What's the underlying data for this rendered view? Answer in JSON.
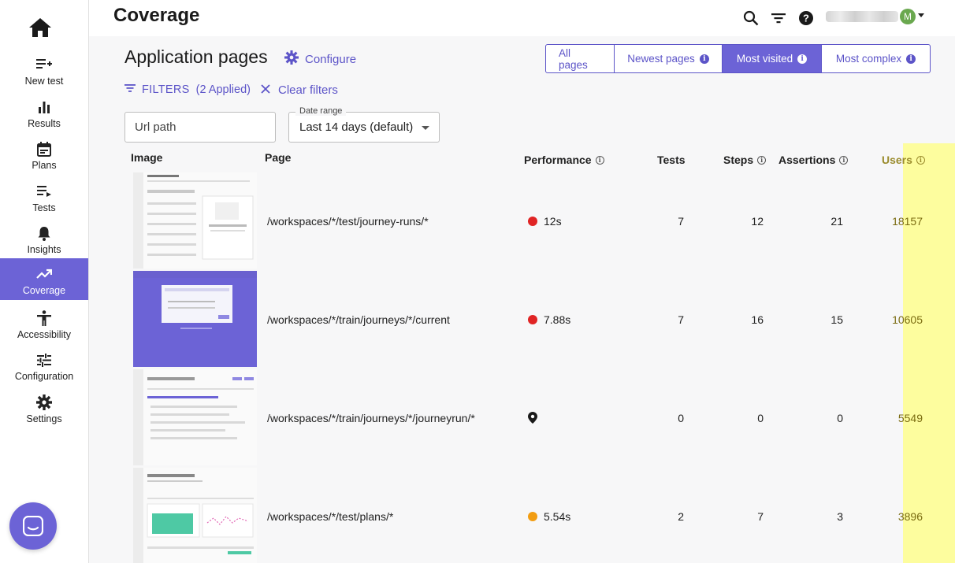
{
  "sidebar": {
    "items": [
      {
        "label": "New test",
        "icon": "playlist-add-icon"
      },
      {
        "label": "Results",
        "icon": "bar-chart-icon"
      },
      {
        "label": "Plans",
        "icon": "calendar-icon"
      },
      {
        "label": "Tests",
        "icon": "playlist-play-icon"
      },
      {
        "label": "Insights",
        "icon": "bell-icon"
      },
      {
        "label": "Coverage",
        "icon": "trending-up-icon"
      },
      {
        "label": "Accessibility",
        "icon": "accessibility-icon"
      },
      {
        "label": "Configuration",
        "icon": "tune-icon"
      },
      {
        "label": "Settings",
        "icon": "gear-icon"
      }
    ],
    "active": "Coverage"
  },
  "header": {
    "title": "Coverage",
    "avatar_initial": "M"
  },
  "main": {
    "section_title": "Application pages",
    "configure_label": "Configure",
    "tabs": [
      {
        "label": "All pages"
      },
      {
        "label": "Newest pages"
      },
      {
        "label": "Most visited"
      },
      {
        "label": "Most complex"
      }
    ],
    "active_tab": "Most visited",
    "filters_label": "FILTERS",
    "filters_applied": "(2 Applied)",
    "clear_filters_label": "Clear filters",
    "url_placeholder": "Url path",
    "date_range_label": "Date range",
    "date_range_value": "Last 14 days (default)"
  },
  "table": {
    "headers": {
      "image": "Image",
      "page": "Page",
      "performance": "Performance",
      "tests": "Tests",
      "steps": "Steps",
      "assertions": "Assertions",
      "users": "Users"
    },
    "rows": [
      {
        "page": "/workspaces/*/test/journey-runs/*",
        "performance": "12s",
        "perf_color": "#e02424",
        "tests": "7",
        "steps": "12",
        "assertions": "21",
        "users": "18157"
      },
      {
        "page": "/workspaces/*/train/journeys/*/current",
        "performance": "7.88s",
        "perf_color": "#e02424",
        "tests": "7",
        "steps": "16",
        "assertions": "15",
        "users": "10605"
      },
      {
        "page": "/workspaces/*/train/journeys/*/journeyrun/*",
        "performance": "",
        "perf_color": "",
        "tests": "0",
        "steps": "0",
        "assertions": "0",
        "users": "5549"
      },
      {
        "page": "/workspaces/*/test/plans/*",
        "performance": "5.54s",
        "perf_color": "#f29d12",
        "tests": "2",
        "steps": "7",
        "assertions": "3",
        "users": "3896"
      }
    ]
  },
  "colors": {
    "accent": "#6c63d6",
    "users_highlight": "#fdfd9e"
  }
}
